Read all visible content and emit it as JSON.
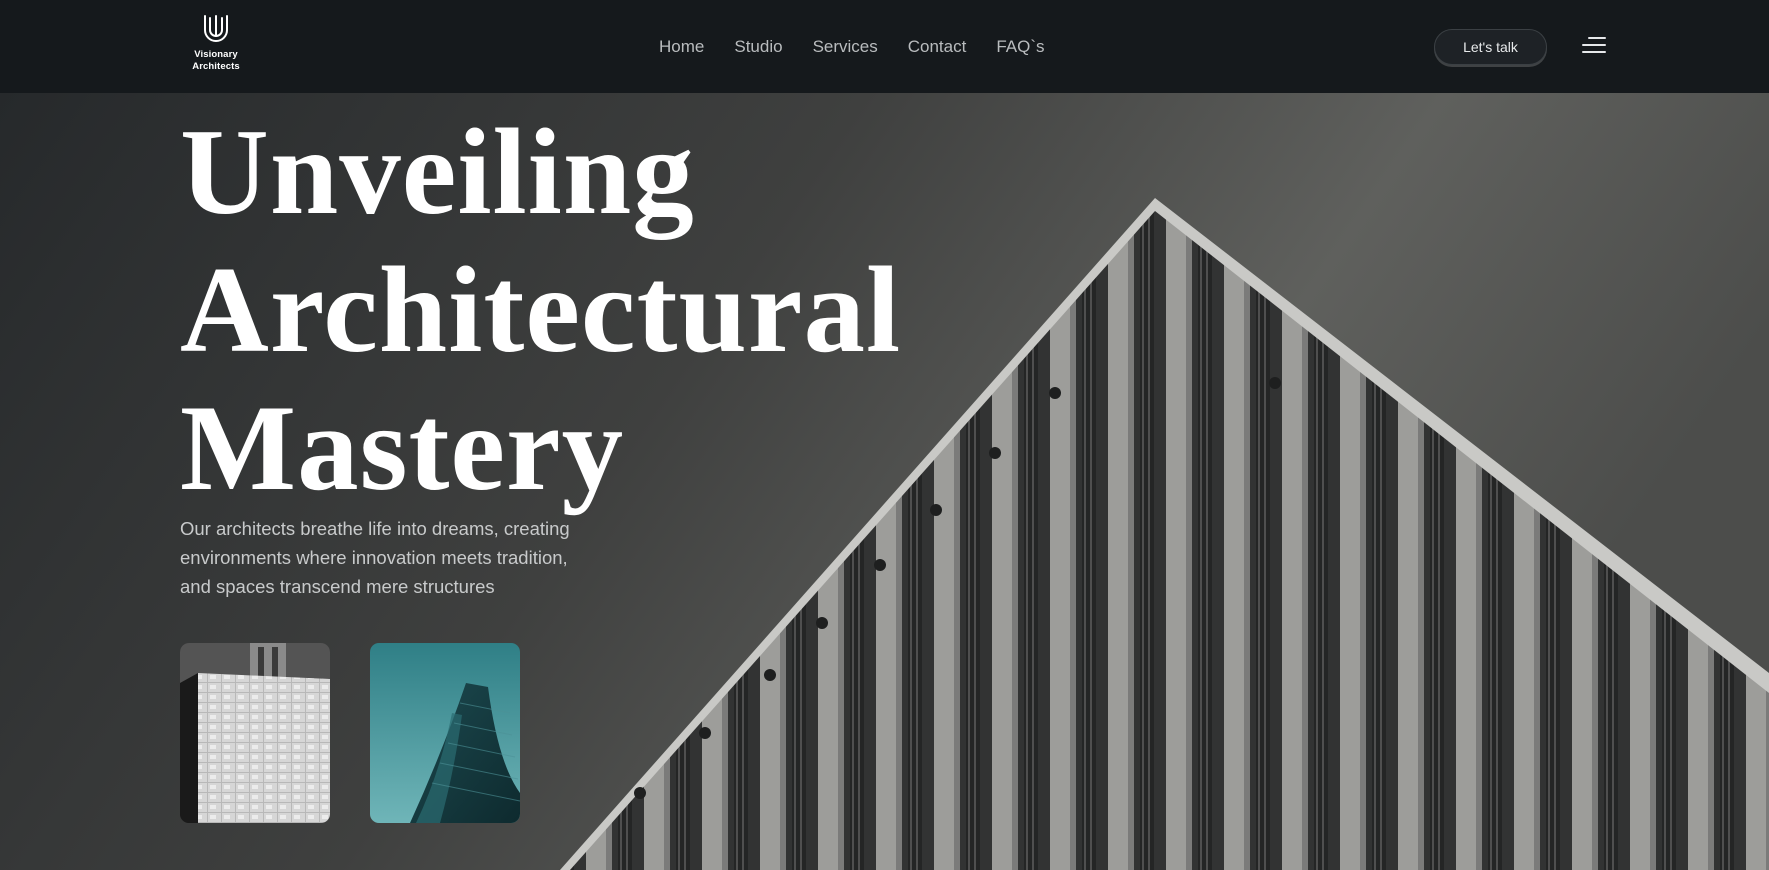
{
  "brand": {
    "name_line1": "Visionary",
    "name_line2": "Architects",
    "logo_icon": "monogram-u-logo-icon"
  },
  "nav": {
    "items": [
      {
        "label": "Home"
      },
      {
        "label": "Studio"
      },
      {
        "label": "Services"
      },
      {
        "label": "Contact"
      },
      {
        "label": "FAQ`s"
      }
    ]
  },
  "header": {
    "cta_label": "Let's talk",
    "menu_icon": "hamburger-menu-icon"
  },
  "hero": {
    "headline_lines": [
      "Unveiling",
      "Architectural",
      "Mastery"
    ],
    "intro_lines": [
      "Our architects breathe life into dreams, creating",
      "environments where innovation meets tradition,",
      "and spaces transcend mere structures"
    ],
    "thumbnails": [
      {
        "subject": "grayscale-building-facade-image"
      },
      {
        "subject": "teal-glass-tower-image"
      }
    ]
  },
  "colors": {
    "header_bg": "#15191c",
    "nav_text": "#b9bcbe",
    "headline": "#ffffff",
    "intro_text": "#c8cacb",
    "thumb_teal": "#3d8f95"
  }
}
